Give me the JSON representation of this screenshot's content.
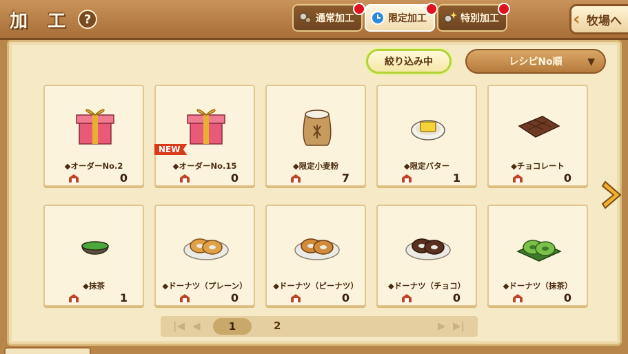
{
  "header": {
    "title": "加 工",
    "help_glyph": "?",
    "tabs": [
      {
        "label": "通常加工",
        "icon": "gears-icon",
        "active": false,
        "notify": true
      },
      {
        "label": "限定加工",
        "icon": "clock-icon",
        "active": true,
        "notify": true
      },
      {
        "label": "特別加工",
        "icon": "sparkle-gears-icon",
        "active": false,
        "notify": true
      }
    ],
    "ranch_label": "牧場へ"
  },
  "toolbar": {
    "filter_label": "絞り込み中",
    "sort_label": "レシピNo順",
    "sort_arrow": "▼"
  },
  "items": [
    {
      "name": "◆オーダーNo.2",
      "qty": "0",
      "icon": "gift-box-icon",
      "new": false
    },
    {
      "name": "◆オーダーNo.15",
      "qty": "0",
      "icon": "gift-box-icon",
      "new": true,
      "badge": "NEW"
    },
    {
      "name": "◆限定小麦粉",
      "qty": "7",
      "icon": "flour-sack-icon",
      "new": false
    },
    {
      "name": "◆限定バター",
      "qty": "1",
      "icon": "butter-dish-icon",
      "new": false
    },
    {
      "name": "◆チョコレート",
      "qty": "0",
      "icon": "chocolate-bar-icon",
      "new": false
    },
    {
      "name": "◆抹茶",
      "qty": "1",
      "icon": "matcha-bowl-icon",
      "new": false
    },
    {
      "name": "◆ドーナツ（プレーン）",
      "qty": "0",
      "icon": "plain-donut-icon",
      "new": false
    },
    {
      "name": "◆ドーナツ（ピーナツ）",
      "qty": "0",
      "icon": "peanut-donut-icon",
      "new": false
    },
    {
      "name": "◆ドーナツ（チョコ）",
      "qty": "0",
      "icon": "choco-donut-icon",
      "new": false
    },
    {
      "name": "◆ドーナツ（抹茶）",
      "qty": "0",
      "icon": "matcha-donut-icon",
      "new": false
    }
  ],
  "pager": {
    "first": "|◀",
    "prev": "◀",
    "pages": [
      "1",
      "2"
    ],
    "current": "1",
    "next": "▶",
    "last": "▶|"
  },
  "colors": {
    "wood": "#b8864a",
    "parchment": "#f6e9c6",
    "accent_green": "#b3d23a",
    "notify_red": "#e0121e"
  }
}
